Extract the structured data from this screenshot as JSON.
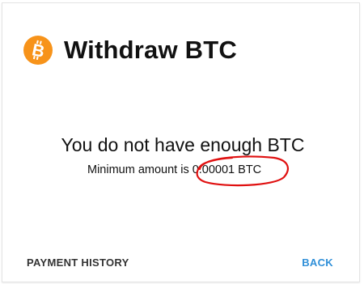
{
  "dialog": {
    "title": "Withdraw BTC",
    "icon": "bitcoin-icon",
    "icon_color": "#f7931a",
    "message": "You do not have enough BTC",
    "minimum_prefix": "Minimum amount is",
    "minimum_amount": "0.00001 BTC",
    "highlight_color": "#e01010"
  },
  "footer": {
    "history_label": "PAYMENT HISTORY",
    "back_label": "BACK",
    "back_color": "#2f8fd8"
  }
}
